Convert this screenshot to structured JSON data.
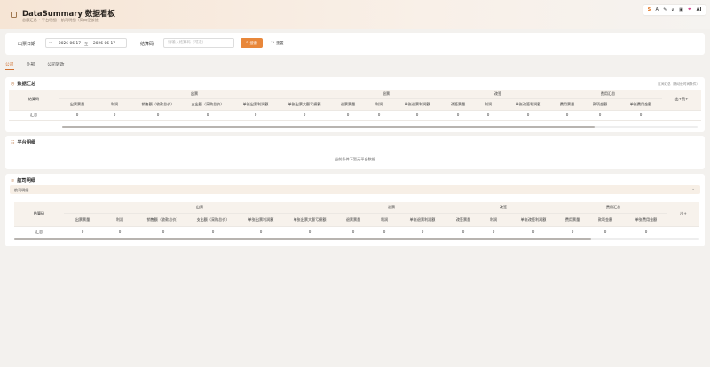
{
  "header": {
    "title": "DataSummary 数据看板",
    "subtitle": "总额汇总 • 平台明细 • 航司明细（同口径核验）"
  },
  "toolbar": {
    "icons": [
      "translate-icon",
      "font-size-icon",
      "theme-icon",
      "mic-icon",
      "capture-icon",
      "favorite-icon",
      "ai-icon"
    ],
    "translate_glyph": "S",
    "font_glyph": "A",
    "theme_glyph": "✎",
    "mic_glyph": "⌀",
    "capture_glyph": "▣",
    "favorite_glyph": "❤",
    "ai_label": "AI"
  },
  "filters": {
    "date_label": "出票日期",
    "date_start": "2026-06-17",
    "date_sep": "至",
    "date_end": "2026-06-17",
    "code_label": "结算码",
    "code_placeholder": "请输入结算码（可选）",
    "search_label": "搜索",
    "reset_label": "重置"
  },
  "tabs": [
    "公司",
    "外部",
    "公司转政"
  ],
  "summary": {
    "title": "数据汇总",
    "note": "区间汇总（随动业时间条件）",
    "row_header": "结算码",
    "groups": [
      "出票",
      "退票",
      "改签",
      "费用汇总"
    ],
    "columns": [
      "出票票量",
      "利润",
      "销售额（收款总价）",
      "支出额（采购总价）",
      "单张出票利润额",
      "单张出票大额亏损额",
      "退票票量",
      "利润",
      "单张退票利润额",
      "改签票量",
      "利润",
      "单张改签利润额",
      "费用票量",
      "款项金额",
      "单张费用金额",
      "出+费+"
    ],
    "row_label": "汇总",
    "values": [
      "0",
      "0",
      "0",
      "0",
      "0",
      "0",
      "0",
      "0",
      "0",
      "0",
      "0",
      "0",
      "0",
      "0",
      "0"
    ]
  },
  "platform": {
    "title": "平台明细",
    "empty": "当前条件下暂无平台数据"
  },
  "airline": {
    "title": "航司明细",
    "panel_label": "航司明细",
    "row_header": "结算码",
    "groups": [
      "出票",
      "退票",
      "改签",
      "费用汇总"
    ],
    "columns": [
      "出票票量",
      "利润",
      "销售额（收款总价）",
      "支出额（采购总价）",
      "单张出票利润额",
      "单张出票大额亏损额",
      "退票票量",
      "利润",
      "单张退票利润额",
      "改签票量",
      "利润",
      "单张改签利润额",
      "费用票量",
      "款项金额",
      "单张费用金额",
      "出+"
    ],
    "row_label": "汇总",
    "values": [
      "0",
      "0",
      "0",
      "0",
      "0",
      "0",
      "0",
      "0",
      "0",
      "0",
      "0",
      "0",
      "0",
      "0",
      "0"
    ]
  }
}
